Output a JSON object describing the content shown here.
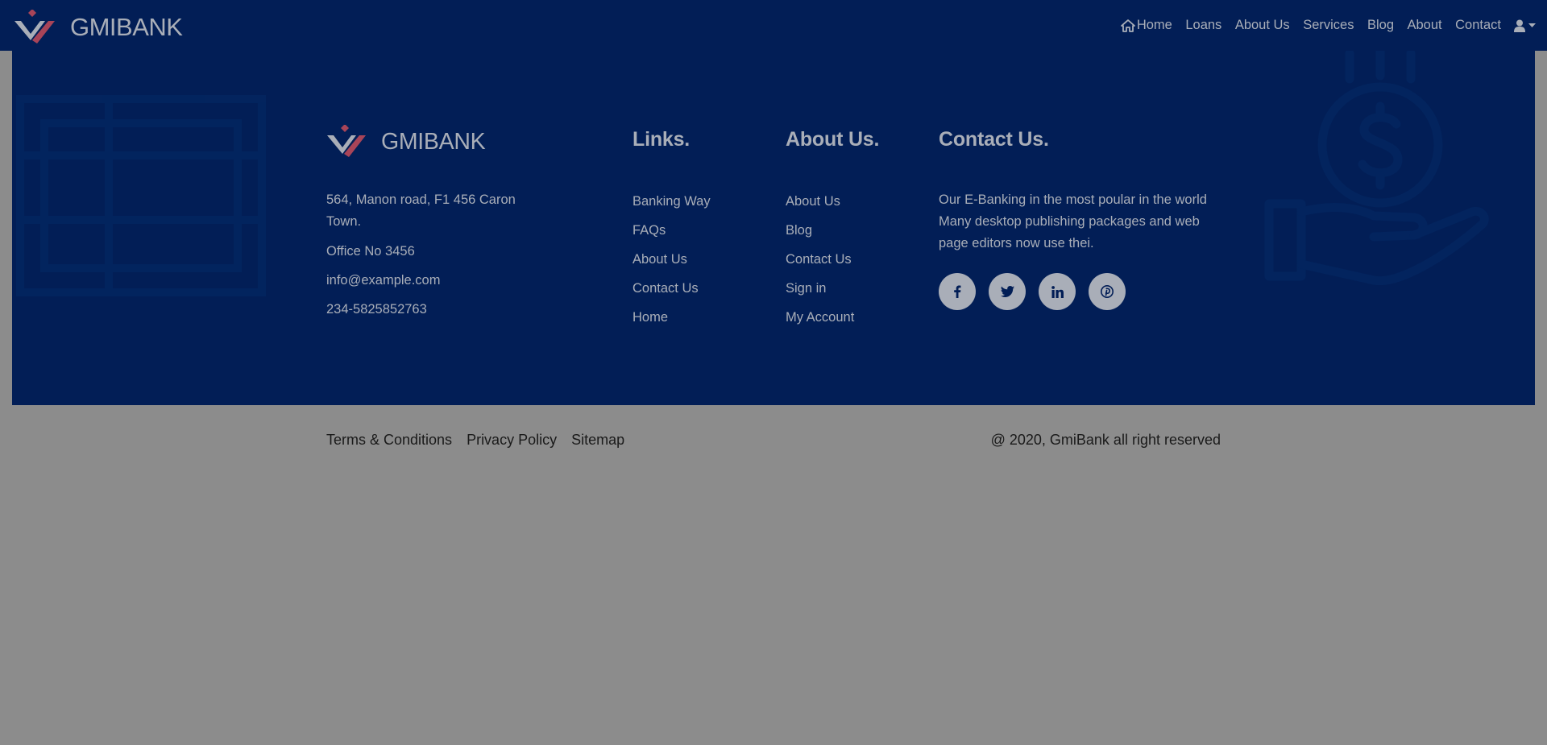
{
  "brand": {
    "name": "GMIBANK",
    "logo_red": "#a84458",
    "logo_grey": "#a9aeb8"
  },
  "nav": {
    "items": [
      "Home",
      "Loans",
      "About Us",
      "Services",
      "Blog",
      "About",
      "Contact"
    ],
    "home_icon": "home-icon",
    "user_icon": "user-icon"
  },
  "footer": {
    "address": "564, Manon road, F1 456 Caron Town.",
    "office": "Office No 3456",
    "email": "info@example.com",
    "phone": "234-5825852763",
    "links_title": "Links.",
    "links": [
      "Banking Way",
      "FAQs",
      "About Us",
      "Contact Us",
      "Home"
    ],
    "about_title": "About Us.",
    "about_links": [
      "About Us",
      "Blog",
      "Contact Us",
      "Sign in",
      "My Account"
    ],
    "contact_title": "Contact Us.",
    "contact_text": "Our E-Banking in the most poular in the world Many desktop publishing packages and web page editors now use thei.",
    "socials": [
      "facebook-icon",
      "twitter-icon",
      "linkedin-icon",
      "pinterest-icon"
    ]
  },
  "bottom": {
    "links": [
      "Terms & Conditions",
      "Privacy Policy",
      "Sitemap"
    ],
    "copyright": "@ 2020, GmiBank all right reserved"
  },
  "colors": {
    "navy": "#021e56",
    "overlay_grey": "#8c8c8c",
    "text_light": "#a9aeb8"
  }
}
